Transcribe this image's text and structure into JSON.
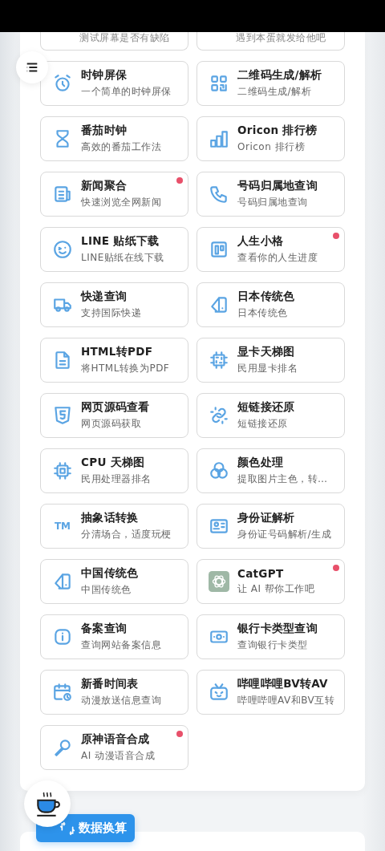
{
  "partial_row": [
    {
      "subtitle": "测试屏幕是否有缺陷"
    },
    {
      "subtitle": "遇到本蛋就发给他吧"
    }
  ],
  "tools": [
    {
      "title": "时钟屏保",
      "subtitle": "一个简单的时钟屏保",
      "new": false
    },
    {
      "title": "二维码生成/解析",
      "subtitle": "二维码生成/解析",
      "new": false
    },
    {
      "title": "番茄时钟",
      "subtitle": "高效的番茄工作法",
      "new": false
    },
    {
      "title": "Oricon 排行榜",
      "subtitle": "Oricon 排行榜",
      "new": false
    },
    {
      "title": "新闻聚合",
      "subtitle": "快速浏览全网新闻",
      "new": true
    },
    {
      "title": "号码归属地查询",
      "subtitle": "号码归属地查询",
      "new": false
    },
    {
      "title": "LINE 贴纸下载",
      "subtitle": "LINE贴纸在线下载",
      "new": false
    },
    {
      "title": "人生小格",
      "subtitle": "查看你的人生进度",
      "new": true
    },
    {
      "title": "快递查询",
      "subtitle": "支持国际快递",
      "new": false
    },
    {
      "title": "日本传统色",
      "subtitle": "日本传统色",
      "new": false
    },
    {
      "title": "HTML转PDF",
      "subtitle": "将HTML转换为PDF",
      "new": false
    },
    {
      "title": "显卡天梯图",
      "subtitle": "民用显卡排名",
      "new": false
    },
    {
      "title": "网页源码查看",
      "subtitle": "网页源码获取",
      "new": false
    },
    {
      "title": "短链接还原",
      "subtitle": "短链接还原",
      "new": false
    },
    {
      "title": "CPU 天梯图",
      "subtitle": "民用处理器排名",
      "new": false
    },
    {
      "title": "颜色处理",
      "subtitle": "提取图片主色，转…",
      "new": false
    },
    {
      "title": "抽象话转换",
      "subtitle": "分清场合，适度玩梗",
      "new": false,
      "mark": "TM"
    },
    {
      "title": "身份证解析",
      "subtitle": "身份证号码解析/生成",
      "new": false
    },
    {
      "title": "中国传统色",
      "subtitle": "中国传统色",
      "new": false
    },
    {
      "title": "CatGPT",
      "subtitle": "让 AI 帮你工作吧",
      "new": true
    },
    {
      "title": "备案查询",
      "subtitle": "查询网站备案信息",
      "new": false
    },
    {
      "title": "银行卡类型查询",
      "subtitle": "查询银行卡类型",
      "new": false
    },
    {
      "title": "新番时间表",
      "subtitle": "动漫放送信息查询",
      "new": false
    },
    {
      "title": "哔哩哔哩BV转AV",
      "subtitle": "哔哩哔哩AV和BV互转",
      "new": false
    },
    {
      "title": "原神语音合成",
      "subtitle": "AI 动漫语音合成",
      "new": true
    }
  ],
  "convert_button": {
    "label": "数据换算"
  }
}
